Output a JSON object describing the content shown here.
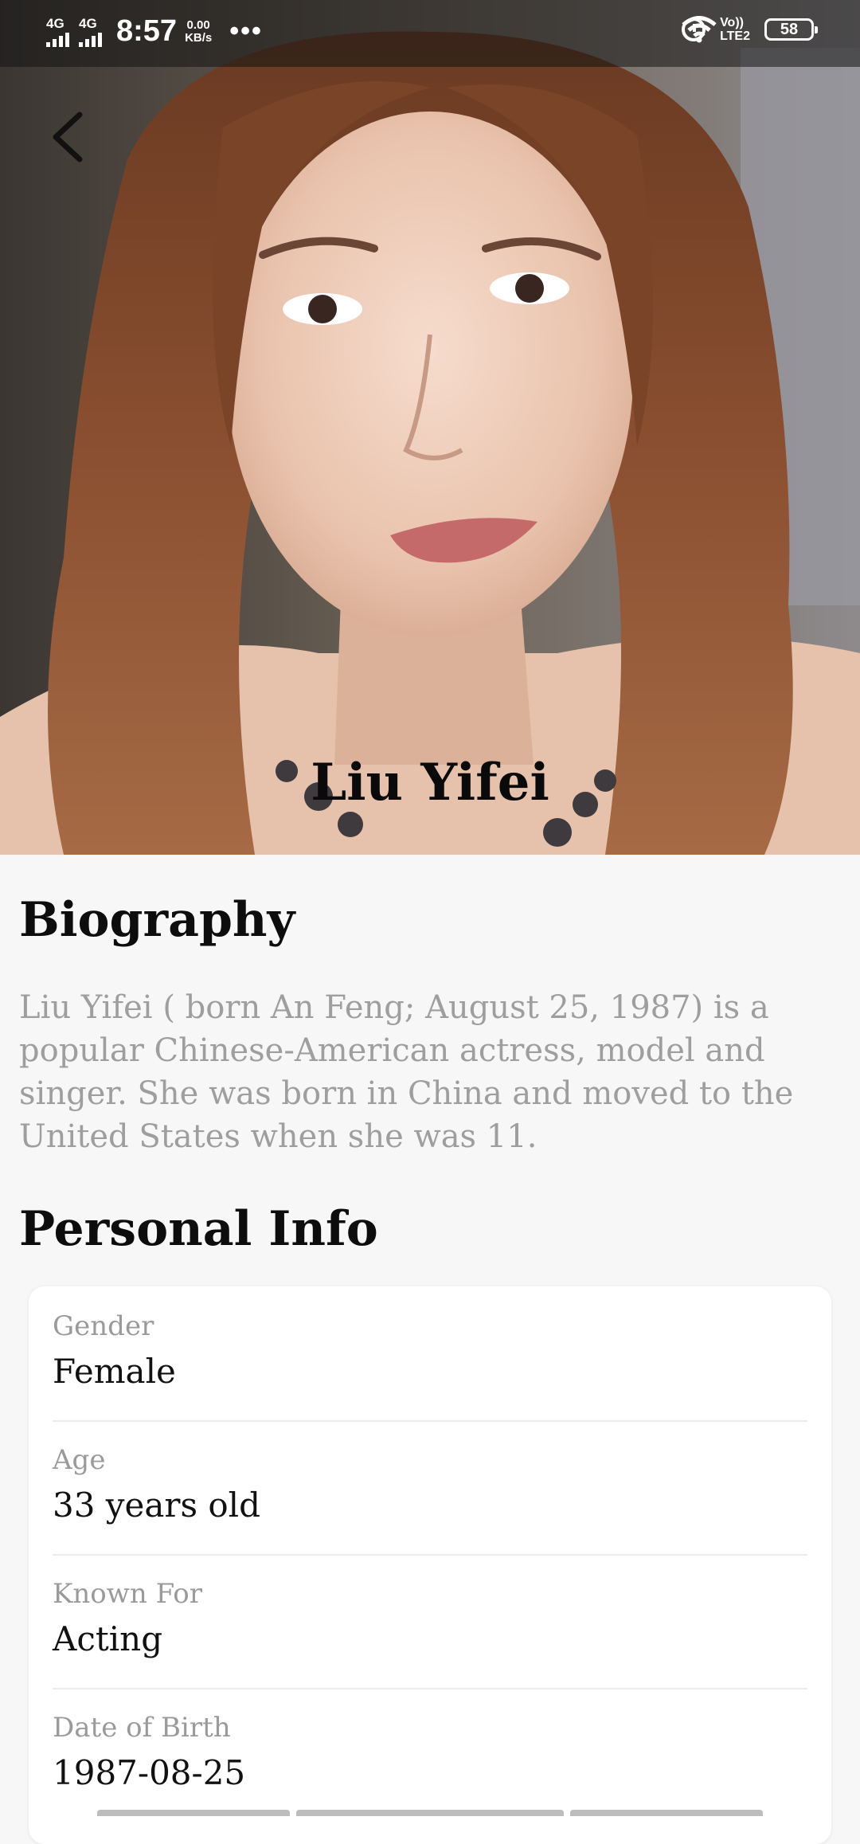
{
  "status_bar": {
    "network1": "4G",
    "network2": "4G",
    "time": "8:57",
    "speed_value": "0.00",
    "speed_unit": "KB/s",
    "more": "•••",
    "volte_top": "Vo))",
    "volte_bottom": "LTE2",
    "battery": "58"
  },
  "hero": {
    "name": "Liu Yifei"
  },
  "biography": {
    "title": "Biography",
    "text": "Liu Yifei ( born An Feng; August 25, 1987) is a popular Chinese-American actress, model and singer. She was born in China and moved to the United States when she was 11."
  },
  "personal_info": {
    "title": "Personal Info",
    "rows": [
      {
        "label": "Gender",
        "value": "Female"
      },
      {
        "label": "Age",
        "value": "33 years old"
      },
      {
        "label": "Known For",
        "value": "Acting"
      },
      {
        "label": "Date of Birth",
        "value": "1987-08-25"
      }
    ]
  },
  "icons": {
    "back": "chevron-left-icon",
    "alarm": "alarm-icon",
    "wifi": "wifi-icon",
    "battery": "battery-icon"
  }
}
